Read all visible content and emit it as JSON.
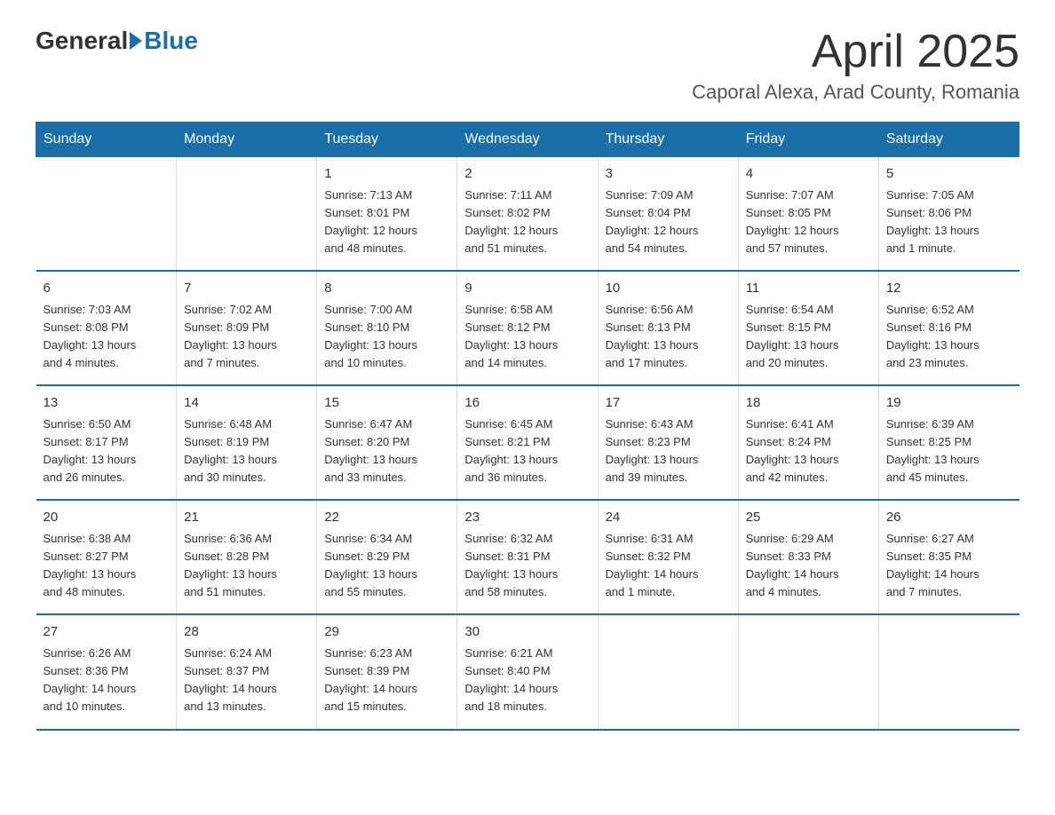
{
  "header": {
    "logo_general": "General",
    "logo_blue": "Blue",
    "month_title": "April 2025",
    "location": "Caporal Alexa, Arad County, Romania"
  },
  "days_of_week": [
    "Sunday",
    "Monday",
    "Tuesday",
    "Wednesday",
    "Thursday",
    "Friday",
    "Saturday"
  ],
  "weeks": [
    [
      {
        "day": "",
        "info": ""
      },
      {
        "day": "",
        "info": ""
      },
      {
        "day": "1",
        "info": "Sunrise: 7:13 AM\nSunset: 8:01 PM\nDaylight: 12 hours\nand 48 minutes."
      },
      {
        "day": "2",
        "info": "Sunrise: 7:11 AM\nSunset: 8:02 PM\nDaylight: 12 hours\nand 51 minutes."
      },
      {
        "day": "3",
        "info": "Sunrise: 7:09 AM\nSunset: 8:04 PM\nDaylight: 12 hours\nand 54 minutes."
      },
      {
        "day": "4",
        "info": "Sunrise: 7:07 AM\nSunset: 8:05 PM\nDaylight: 12 hours\nand 57 minutes."
      },
      {
        "day": "5",
        "info": "Sunrise: 7:05 AM\nSunset: 8:06 PM\nDaylight: 13 hours\nand 1 minute."
      }
    ],
    [
      {
        "day": "6",
        "info": "Sunrise: 7:03 AM\nSunset: 8:08 PM\nDaylight: 13 hours\nand 4 minutes."
      },
      {
        "day": "7",
        "info": "Sunrise: 7:02 AM\nSunset: 8:09 PM\nDaylight: 13 hours\nand 7 minutes."
      },
      {
        "day": "8",
        "info": "Sunrise: 7:00 AM\nSunset: 8:10 PM\nDaylight: 13 hours\nand 10 minutes."
      },
      {
        "day": "9",
        "info": "Sunrise: 6:58 AM\nSunset: 8:12 PM\nDaylight: 13 hours\nand 14 minutes."
      },
      {
        "day": "10",
        "info": "Sunrise: 6:56 AM\nSunset: 8:13 PM\nDaylight: 13 hours\nand 17 minutes."
      },
      {
        "day": "11",
        "info": "Sunrise: 6:54 AM\nSunset: 8:15 PM\nDaylight: 13 hours\nand 20 minutes."
      },
      {
        "day": "12",
        "info": "Sunrise: 6:52 AM\nSunset: 8:16 PM\nDaylight: 13 hours\nand 23 minutes."
      }
    ],
    [
      {
        "day": "13",
        "info": "Sunrise: 6:50 AM\nSunset: 8:17 PM\nDaylight: 13 hours\nand 26 minutes."
      },
      {
        "day": "14",
        "info": "Sunrise: 6:48 AM\nSunset: 8:19 PM\nDaylight: 13 hours\nand 30 minutes."
      },
      {
        "day": "15",
        "info": "Sunrise: 6:47 AM\nSunset: 8:20 PM\nDaylight: 13 hours\nand 33 minutes."
      },
      {
        "day": "16",
        "info": "Sunrise: 6:45 AM\nSunset: 8:21 PM\nDaylight: 13 hours\nand 36 minutes."
      },
      {
        "day": "17",
        "info": "Sunrise: 6:43 AM\nSunset: 8:23 PM\nDaylight: 13 hours\nand 39 minutes."
      },
      {
        "day": "18",
        "info": "Sunrise: 6:41 AM\nSunset: 8:24 PM\nDaylight: 13 hours\nand 42 minutes."
      },
      {
        "day": "19",
        "info": "Sunrise: 6:39 AM\nSunset: 8:25 PM\nDaylight: 13 hours\nand 45 minutes."
      }
    ],
    [
      {
        "day": "20",
        "info": "Sunrise: 6:38 AM\nSunset: 8:27 PM\nDaylight: 13 hours\nand 48 minutes."
      },
      {
        "day": "21",
        "info": "Sunrise: 6:36 AM\nSunset: 8:28 PM\nDaylight: 13 hours\nand 51 minutes."
      },
      {
        "day": "22",
        "info": "Sunrise: 6:34 AM\nSunset: 8:29 PM\nDaylight: 13 hours\nand 55 minutes."
      },
      {
        "day": "23",
        "info": "Sunrise: 6:32 AM\nSunset: 8:31 PM\nDaylight: 13 hours\nand 58 minutes."
      },
      {
        "day": "24",
        "info": "Sunrise: 6:31 AM\nSunset: 8:32 PM\nDaylight: 14 hours\nand 1 minute."
      },
      {
        "day": "25",
        "info": "Sunrise: 6:29 AM\nSunset: 8:33 PM\nDaylight: 14 hours\nand 4 minutes."
      },
      {
        "day": "26",
        "info": "Sunrise: 6:27 AM\nSunset: 8:35 PM\nDaylight: 14 hours\nand 7 minutes."
      }
    ],
    [
      {
        "day": "27",
        "info": "Sunrise: 6:26 AM\nSunset: 8:36 PM\nDaylight: 14 hours\nand 10 minutes."
      },
      {
        "day": "28",
        "info": "Sunrise: 6:24 AM\nSunset: 8:37 PM\nDaylight: 14 hours\nand 13 minutes."
      },
      {
        "day": "29",
        "info": "Sunrise: 6:23 AM\nSunset: 8:39 PM\nDaylight: 14 hours\nand 15 minutes."
      },
      {
        "day": "30",
        "info": "Sunrise: 6:21 AM\nSunset: 8:40 PM\nDaylight: 14 hours\nand 18 minutes."
      },
      {
        "day": "",
        "info": ""
      },
      {
        "day": "",
        "info": ""
      },
      {
        "day": "",
        "info": ""
      }
    ]
  ]
}
